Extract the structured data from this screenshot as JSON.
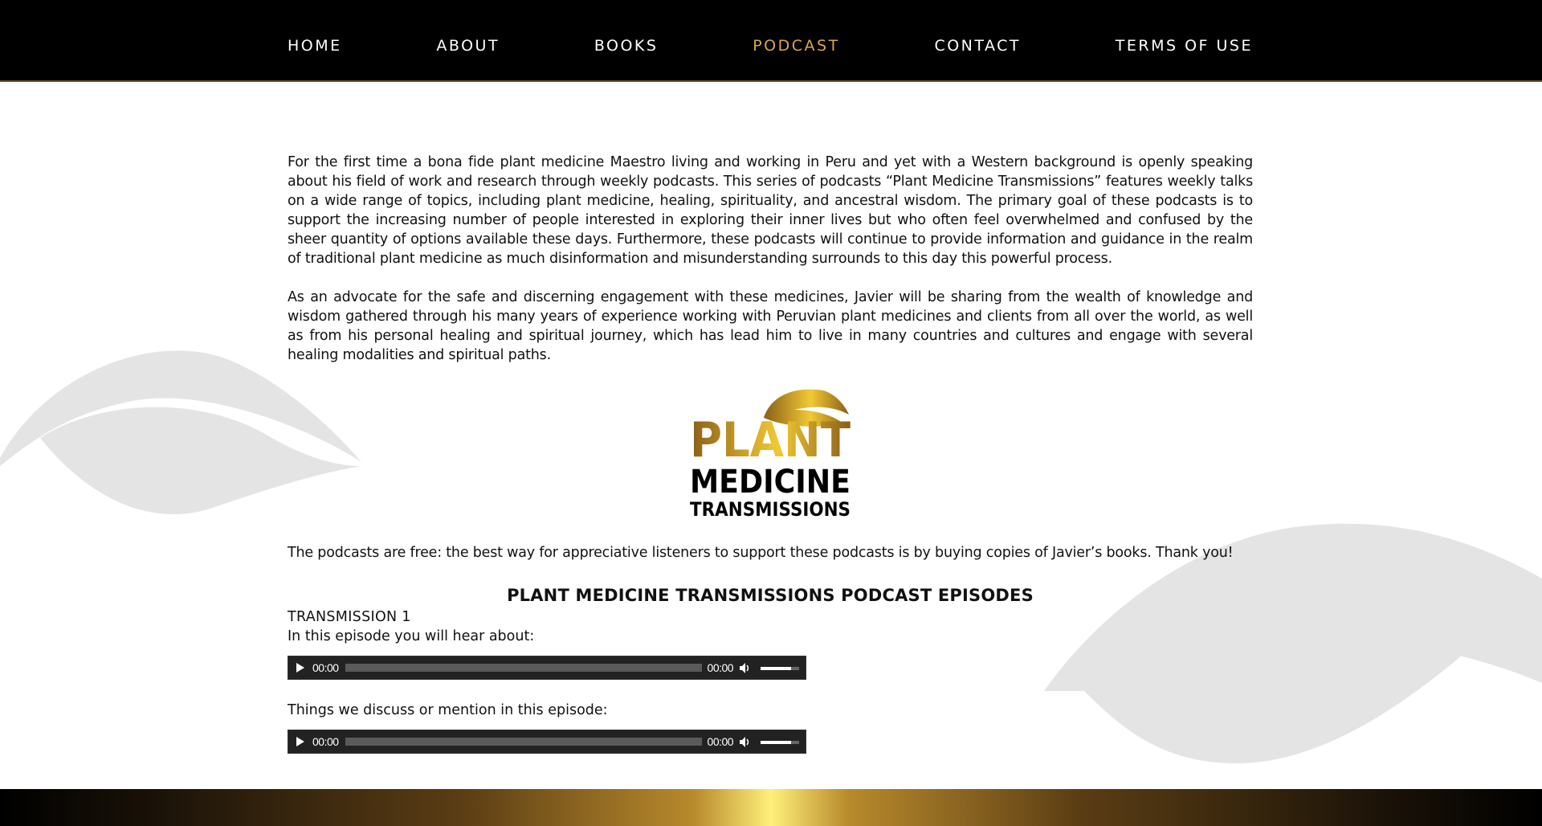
{
  "nav": {
    "items": [
      {
        "label": "HOME",
        "active": false
      },
      {
        "label": "ABOUT",
        "active": false
      },
      {
        "label": "BOOKS",
        "active": false
      },
      {
        "label": "PODCAST",
        "active": true
      },
      {
        "label": "CONTACT",
        "active": false
      },
      {
        "label": "TERMS OF USE",
        "active": false
      }
    ]
  },
  "intro": {
    "paragraph1": "For the first time a bona fide plant medicine Maestro living and working in Peru and yet with a Western background is openly speaking about his field of work and research through weekly podcasts. This series of podcasts “Plant Medicine Transmissions” features weekly talks on a wide range of topics, including plant medicine, healing, spirituality, and ancestral wisdom. The primary goal of these podcasts is to support the increasing number of people interested in exploring their inner lives but who often feel overwhelmed and confused by the sheer quantity of options available these days. Furthermore, these podcasts will continue to provide information and guidance in the realm of traditional plant medicine as much disinformation and misunderstanding surrounds to this day this powerful process.",
    "paragraph2": "As an advocate for the safe and discerning engagement with these medicines, Javier will be sharing from the wealth of knowledge and wisdom gathered through his many years of experience working with Peruvian plant medicines and clients from all over the world, as well as from his personal healing and spiritual journey, which has lead him to live in many countries and cultures and engage with several healing modalities and spiritual paths."
  },
  "logo": {
    "line1": "PLANT",
    "line2": "MEDICINE",
    "line3": "TRANSMISSIONS"
  },
  "support_text": "The podcasts are free: the best way for appreciative listeners to support these podcasts is by buying copies of Javier’s books. Thank you!",
  "episodes": {
    "heading": "PLANT MEDICINE TRANSMISSIONS PODCAST EPISODES",
    "transmission_title": "TRANSMISSION 1",
    "intro_text": "In this episode you will hear about:",
    "discuss_text": "Things we discuss or mention in this episode:",
    "players": [
      {
        "current_time": "00:00",
        "total_time": "00:00",
        "volume": 0.8
      },
      {
        "current_time": "00:00",
        "total_time": "00:00",
        "volume": 0.8
      }
    ]
  },
  "colors": {
    "nav_bg": "#000000",
    "nav_active": "#d8a84a",
    "gold_light": "#f5d13c",
    "gold_dark": "#8a5f18",
    "leaf_gray": "#e3e3e3"
  }
}
